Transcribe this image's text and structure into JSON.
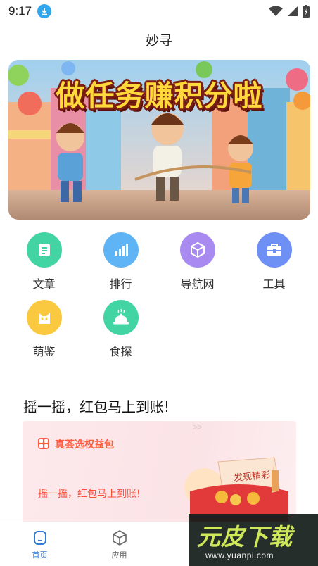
{
  "status_bar": {
    "time": "9:17"
  },
  "app": {
    "title": "妙寻"
  },
  "banner": {
    "headline": "做任务赚积分啦"
  },
  "grid": {
    "items": [
      {
        "label": "文章",
        "icon": "article-icon",
        "color": "#43d4a3"
      },
      {
        "label": "排行",
        "icon": "bar-chart-icon",
        "color": "#5eb4f4"
      },
      {
        "label": "导航网",
        "icon": "cube-icon",
        "color": "#a88af0"
      },
      {
        "label": "工具",
        "icon": "toolbox-icon",
        "color": "#6e8ff3"
      },
      {
        "label": "萌鉴",
        "icon": "cat-icon",
        "color": "#fbc93f"
      },
      {
        "label": "食探",
        "icon": "food-cloche-icon",
        "color": "#43d4a3"
      }
    ]
  },
  "promo": {
    "heading": "摇一摇，红包马上到账!",
    "card_brand": "真荟选权益包",
    "card_text": "摇一摇，红包马上到账!",
    "envelope_text": "发现精彩"
  },
  "bottom_nav": {
    "items": [
      {
        "label": "首页",
        "icon": "home-icon",
        "active": true
      },
      {
        "label": "应用",
        "icon": "cube-icon",
        "active": false
      }
    ],
    "active_color": "#2f7bd6"
  },
  "watermark": {
    "logo": "元皮下载",
    "url": "www.yuanpi.com"
  }
}
